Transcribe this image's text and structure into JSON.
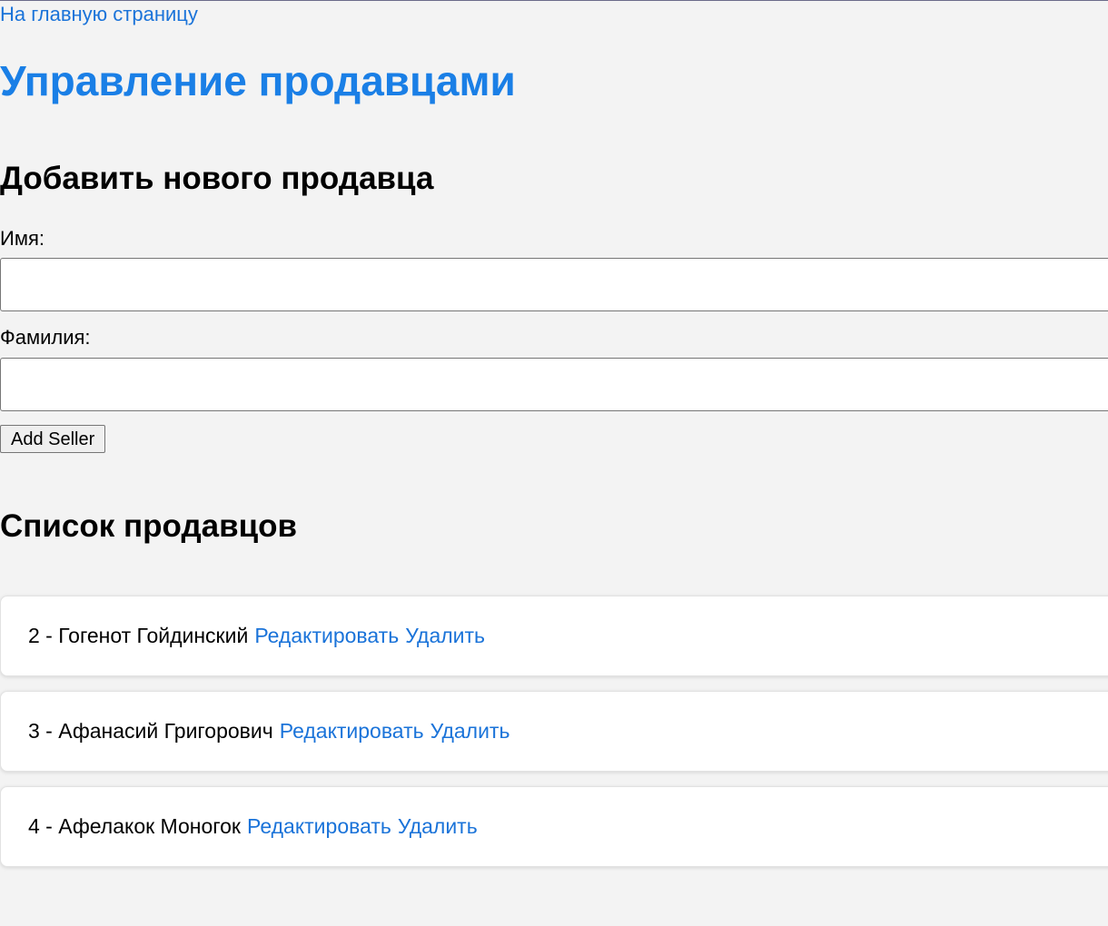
{
  "nav": {
    "home_link": "На главную страницу"
  },
  "page": {
    "title": "Управление продавцами"
  },
  "add_form": {
    "heading": "Добавить нового продавца",
    "first_name_label": "Имя:",
    "first_name_value": "",
    "last_name_label": "Фамилия:",
    "last_name_value": "",
    "submit_label": "Add Seller"
  },
  "seller_list": {
    "heading": "Список продавцов",
    "items": [
      {
        "text": "2 - Гогенот Гойдинский",
        "edit_label": "Редактировать",
        "delete_label": "Удалить"
      },
      {
        "text": "3 - Афанасий Григорович",
        "edit_label": "Редактировать",
        "delete_label": "Удалить"
      },
      {
        "text": "4 - Афелакок Моногок",
        "edit_label": "Редактировать",
        "delete_label": "Удалить"
      }
    ]
  },
  "colors": {
    "link": "#1a73d9",
    "title": "#1a7fe6",
    "background": "#f3f3f3"
  }
}
